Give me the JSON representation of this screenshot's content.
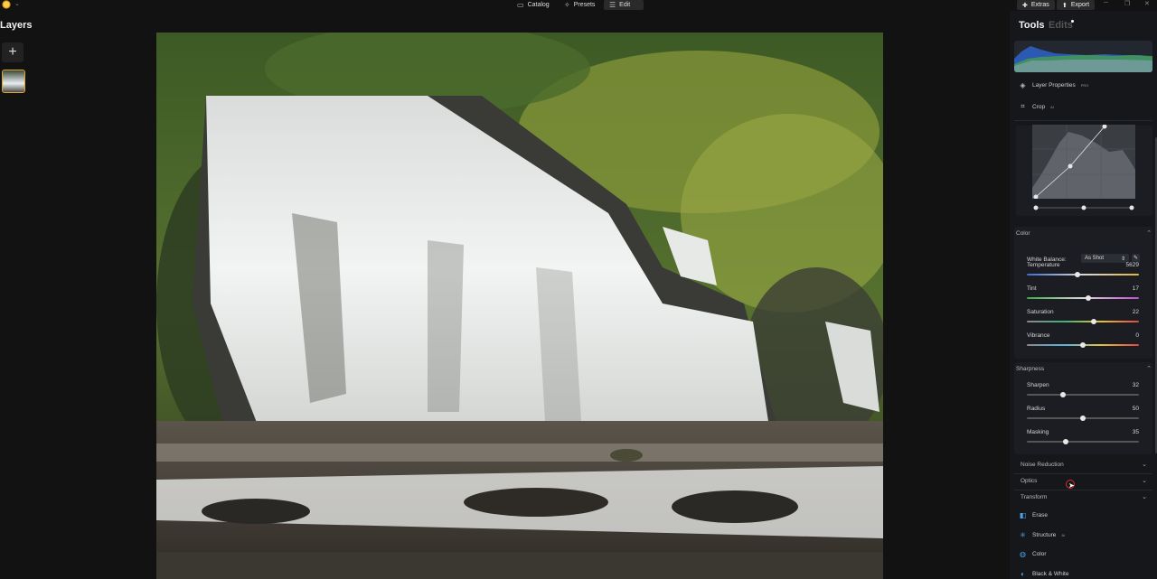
{
  "topbar": {
    "modes": [
      {
        "label": "Catalog",
        "icon": "folder-icon"
      },
      {
        "label": "Presets",
        "icon": "sparkle-icon"
      },
      {
        "label": "Edit",
        "icon": "sliders-icon",
        "active": true
      }
    ],
    "extras_label": "Extras",
    "export_label": "Export"
  },
  "layers": {
    "title": "Layers",
    "add_label": "+"
  },
  "tools_panel": {
    "tab_tools": "Tools",
    "tab_edits": "Edits",
    "tool_items": [
      {
        "label": "Layer Properties",
        "badge": "PRO",
        "icon": "layers-icon"
      },
      {
        "label": "Crop",
        "badge": "AI",
        "icon": "crop-icon"
      }
    ],
    "color": {
      "title": "Color",
      "white_balance_label": "White Balance:",
      "white_balance_value": "As Shot",
      "sliders": [
        {
          "label": "Temperature",
          "value": "5629",
          "position": 0.45
        },
        {
          "label": "Tint",
          "value": "17",
          "position": 0.55
        },
        {
          "label": "Saturation",
          "value": "22",
          "position": 0.6
        },
        {
          "label": "Vibrance",
          "value": "0",
          "position": 0.5
        }
      ]
    },
    "sharpness": {
      "title": "Sharpness",
      "sliders": [
        {
          "label": "Sharpen",
          "value": "32",
          "position": 0.32
        },
        {
          "label": "Radius",
          "value": "50",
          "position": 0.5
        },
        {
          "label": "Masking",
          "value": "35",
          "position": 0.35
        }
      ]
    },
    "collapsed_sections": [
      "Noise Reduction",
      "Optics",
      "Transform"
    ],
    "bottom_tools": [
      {
        "label": "Erase",
        "badge": "",
        "icon": "eraser-icon"
      },
      {
        "label": "Structure",
        "badge": "AI",
        "icon": "structure-icon"
      },
      {
        "label": "Color",
        "badge": "",
        "icon": "palette-icon"
      },
      {
        "label": "Black & White",
        "badge": "",
        "icon": "bw-icon"
      }
    ]
  },
  "colors": {
    "accent_gold": "#e0a42e",
    "cursor_red": "#d32f2f"
  }
}
